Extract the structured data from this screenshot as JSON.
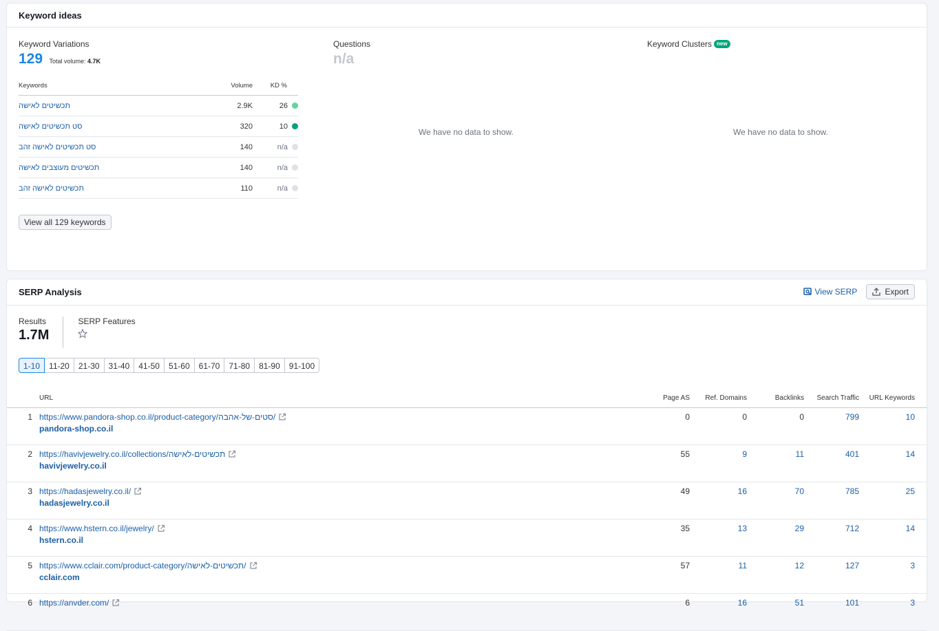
{
  "keyword_ideas": {
    "title": "Keyword ideas",
    "variations": {
      "title": "Keyword Variations",
      "count": "129",
      "total_volume_label": "Total volume:",
      "total_volume": "4.7K",
      "columns": {
        "keyword": "Keywords",
        "volume": "Volume",
        "kd": "KD %"
      },
      "rows": [
        {
          "keyword": "תכשיטים לאישה",
          "volume": "2.9K",
          "kd": "26",
          "kd_color": "#5cd89d"
        },
        {
          "keyword": "סט תכשיטים לאישה",
          "volume": "320",
          "kd": "10",
          "kd_color": "#009f81"
        },
        {
          "keyword": "סט תכשיטים לאישה זהב",
          "volume": "140",
          "kd": "n/a",
          "kd_color": "#dfe1e6"
        },
        {
          "keyword": "תכשיטים מעוצבים לאישה",
          "volume": "140",
          "kd": "n/a",
          "kd_color": "#dfe1e6"
        },
        {
          "keyword": "תכשיטים לאישה זהב",
          "volume": "110",
          "kd": "n/a",
          "kd_color": "#dfe1e6"
        }
      ],
      "view_all_label": "View all 129 keywords"
    },
    "questions": {
      "title": "Questions",
      "value": "n/a",
      "empty_text": "We have no data to show."
    },
    "clusters": {
      "title": "Keyword Clusters",
      "badge": "new",
      "empty_text": "We have no data to show."
    }
  },
  "serp": {
    "title": "SERP Analysis",
    "view_serp_label": "View SERP",
    "export_label": "Export",
    "results_label": "Results",
    "results_value": "1.7M",
    "features_label": "SERP Features",
    "pages": [
      "1-10",
      "11-20",
      "21-30",
      "31-40",
      "41-50",
      "51-60",
      "61-70",
      "71-80",
      "81-90",
      "91-100"
    ],
    "columns": {
      "url": "URL",
      "page_as": "Page AS",
      "ref_domains": "Ref. Domains",
      "backlinks": "Backlinks",
      "search_traffic": "Search Traffic",
      "url_keywords": "URL Keywords"
    },
    "rows": [
      {
        "index": "1",
        "url": "https://www.pandora-shop.co.il/product-category/סטים-של-אהבה/",
        "domain": "pandora-shop.co.il",
        "page_as": "0",
        "ref_domains": "0",
        "backlinks": "0",
        "search_traffic": "799",
        "url_keywords": "10"
      },
      {
        "index": "2",
        "url": "https://havivjewelry.co.il/collections/תכשיטים-לאישה",
        "domain": "havivjewelry.co.il",
        "page_as": "55",
        "ref_domains": "9",
        "backlinks": "11",
        "search_traffic": "401",
        "url_keywords": "14"
      },
      {
        "index": "3",
        "url": "https://hadasjewelry.co.il/",
        "domain": "hadasjewelry.co.il",
        "page_as": "49",
        "ref_domains": "16",
        "backlinks": "70",
        "search_traffic": "785",
        "url_keywords": "25"
      },
      {
        "index": "4",
        "url": "https://www.hstern.co.il/jewelry/",
        "domain": "hstern.co.il",
        "page_as": "35",
        "ref_domains": "13",
        "backlinks": "29",
        "search_traffic": "712",
        "url_keywords": "14"
      },
      {
        "index": "5",
        "url": "https://www.cclair.com/product-category/תכשיטים-לאישה/",
        "domain": "cclair.com",
        "page_as": "57",
        "ref_domains": "11",
        "backlinks": "12",
        "search_traffic": "127",
        "url_keywords": "3"
      },
      {
        "index": "6",
        "url": "https://anvder.com/",
        "domain": "",
        "page_as": "6",
        "ref_domains": "16",
        "backlinks": "51",
        "search_traffic": "101",
        "url_keywords": "3"
      }
    ]
  }
}
